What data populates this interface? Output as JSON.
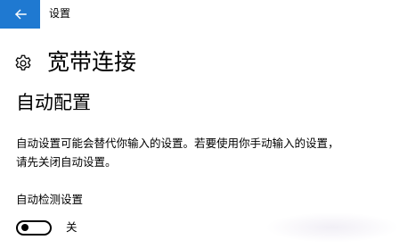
{
  "window": {
    "title": "设置"
  },
  "header": {
    "icon": "gear-icon",
    "title": "宽带连接"
  },
  "section": {
    "title": "自动配置",
    "description_lines": [
      "自动设置可能会替代你输入的设置。若要使用你手动输入的设置，",
      "请先关闭自动设置。"
    ]
  },
  "setting": {
    "label": "自动检测设置",
    "toggle_state_label": "关",
    "toggle_on": false
  },
  "colors": {
    "accent": "#1f79d1",
    "background": "#ffffff",
    "text": "#000000"
  }
}
